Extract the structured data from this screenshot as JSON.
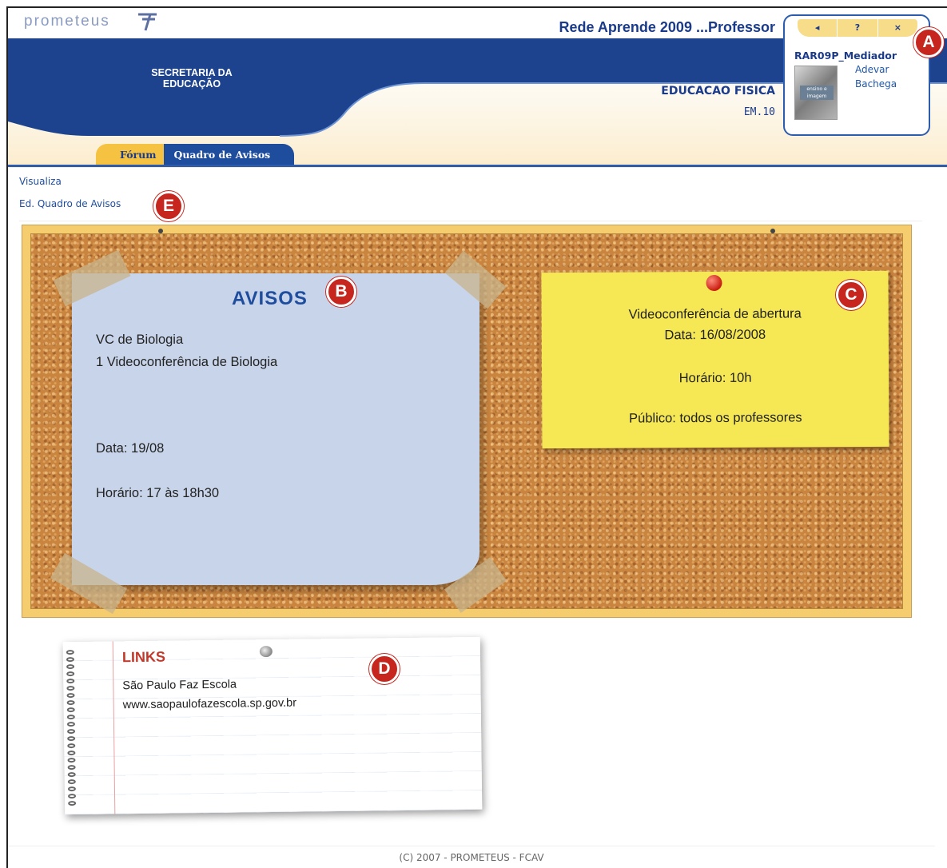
{
  "header": {
    "logo_text": "prometeus",
    "secretaria": "SECRETARIA DA EDUCAÇÃO",
    "app_title": "Rede Aprende 2009 ...Professor",
    "course_name": "EDUCACAO FISICA",
    "course_code": "EM.10"
  },
  "user_panel": {
    "nav_back": "◂",
    "nav_help": "?",
    "nav_close": "×",
    "username": "RAR09P_Mediador",
    "first_name": "Adevar",
    "last_name": "Bachega",
    "avatar_label": "ensino e imagem"
  },
  "tabs": [
    {
      "label": "Fórum"
    },
    {
      "label": "Quadro de Avisos"
    }
  ],
  "side_links": {
    "visualiza": "Visualiza",
    "edit": "Ed. Quadro de Avisos"
  },
  "board": {
    "avisos": {
      "title": "AVISOS",
      "line1": "VC de Biologia",
      "line2": "1 Videoconferência de Biologia",
      "date": "Data: 19/08",
      "time": "Horário: 17 às 18h30"
    },
    "yellow": {
      "line1": "Videoconferência de abertura",
      "line2": "Data: 16/08/2008",
      "line3": "Horário: 10h",
      "line4": "Público: todos os professores"
    },
    "links": {
      "title": "LINKS",
      "line1": "São Paulo Faz Escola",
      "line2": "www.saopaulofazescola.sp.gov.br"
    }
  },
  "markers": {
    "a": "A",
    "b": "B",
    "c": "C",
    "d": "D",
    "e": "E"
  },
  "footer": "(C) 2007 - PROMETEUS - FCAV",
  "colors": {
    "brand_blue": "#1f4d9e",
    "tab_gold": "#f5c242",
    "marker_red": "#c6261e",
    "note_yellow": "#f6e854",
    "note_blue": "#c8d4ea"
  }
}
